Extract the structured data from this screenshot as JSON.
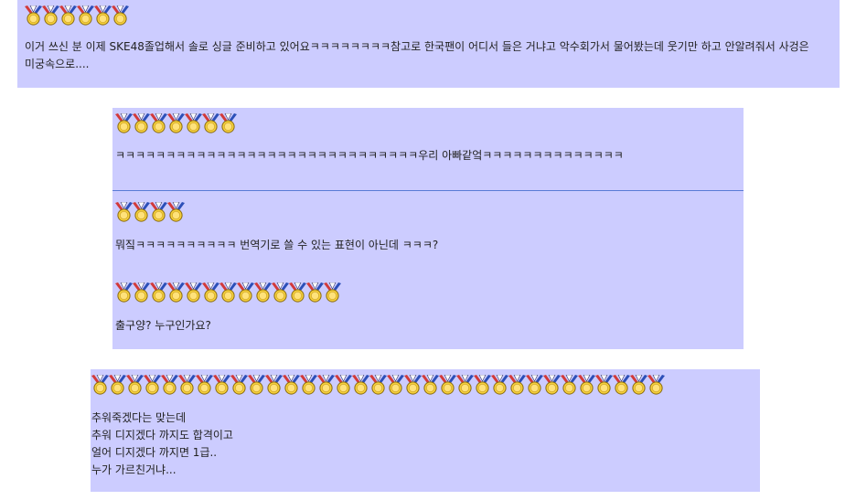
{
  "comments": [
    {
      "medal_count": 6,
      "text": "이거 쓰신 분 이제 SKE48졸업해서 솔로 싱글 준비하고 있어요ㅋㅋㅋㅋㅋㅋㅋㅋ참고로 한국팬이 어디서 들은 거냐고 악수회가서 물어봤는데 웃기만 하고 안알려줘서 사겅은 미궁속으로...."
    },
    {
      "medal_count": 7,
      "text": "ㅋㅋㅋㅋㅋㅋㅋㅋㅋㅋㅋㅋㅋㅋㅋㅋㅋㅋㅋㅋㅋㅋㅋㅋㅋㅋㅋㅋㅋㅋ우리 아빠같엌ㅋㅋㅋㅋㅋㅋㅋㅋㅋㅋㅋㅋㅋㅋ"
    },
    {
      "medal_count": 4,
      "text": "뭐짘ㅋㅋㅋㅋㅋㅋㅋㅋㅋㅋ 번역기로 쓸 수 있는 표현이 아닌데 ㅋㅋㅋ?"
    },
    {
      "medal_count": 13,
      "text": "출구양? 누구인가요?"
    },
    {
      "medal_count": 33,
      "lines": [
        "추워죽겠다는 맞는데",
        "추워 디지겠다 까지도 합격이고",
        "얼어 디지겠다 까지면 1급..",
        "누가 가르친거냐..."
      ]
    }
  ],
  "colors": {
    "comment_bg": "#ccccff",
    "divider": "#5a7bd6",
    "text": "#222222"
  },
  "icons": {
    "medal": "gold-medal-icon"
  }
}
